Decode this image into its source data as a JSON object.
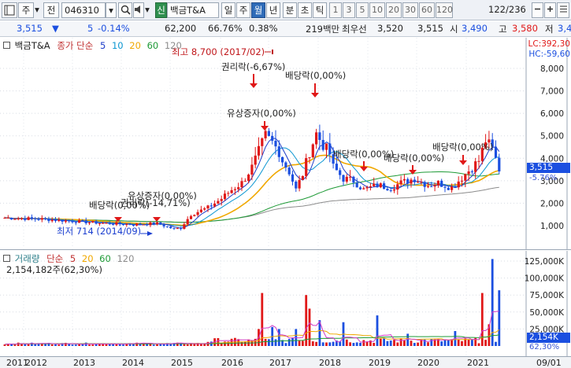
{
  "toolbar": {
    "type_label": "주",
    "jeon_label": "전",
    "code": "046310",
    "badge": "신",
    "name": "백금T&A",
    "periods": [
      "일",
      "주",
      "월",
      "년"
    ],
    "intervals": [
      "분",
      "초",
      "틱"
    ],
    "numbers": [
      "1",
      "3",
      "5",
      "10",
      "20",
      "30",
      "60",
      "120"
    ],
    "count": "122",
    "total": "/236"
  },
  "quote": {
    "price": "3,515",
    "arrow": "▼",
    "change": "5",
    "change_pct": "-0.14%",
    "volume": "62,200",
    "vol_ratio": "66.76%",
    "turnover": "0.38%",
    "amount": "219백만",
    "best_label": "최우선",
    "best_ask": "3,520",
    "best_bid": "3,515",
    "open_label": "시",
    "open": "3,490",
    "high_label": "고",
    "high": "3,580",
    "low_label": "저",
    "low": "3,4"
  },
  "price_chart": {
    "legend_name": "백금T&A",
    "legend_type": "종가 단순",
    "ma_periods": [
      "5",
      "10",
      "20",
      "60",
      "120"
    ],
    "lc": "LC:392,30",
    "hc": "HC:-59,60",
    "current": "3,515",
    "ma_pct": "-5.76%",
    "y_ticks": [
      "8,000",
      "7,000",
      "6,000",
      "5,000",
      "4,000",
      "3,000",
      "2,000",
      "1,000"
    ],
    "annotations": {
      "high": "최고 8,700 (2017/02)",
      "low": "최저 714 (2014/09)",
      "rights": "권리락(-6,67%)",
      "div_2017": "배당락(0,00%)",
      "paid_in": "유상증자(0,00%)",
      "div_2018": "배당락(0,00%)",
      "div_2019": "배당락(0,00%)",
      "div_2020": "배당락(0,00%)",
      "div_2014": "배당락(0,00%)",
      "paid_in_2014": "유상증자(0,00%)",
      "rights_2014": "권리락(-14,71%)"
    }
  },
  "volume_chart": {
    "legend_name": "거래량",
    "legend_type": "단순",
    "ma_periods": [
      "5",
      "20",
      "60",
      "120"
    ],
    "info": "2,154,182주(62,30%)",
    "y_ticks": [
      "125,000K",
      "100,000K",
      "75,000K",
      "50,000K",
      "25,000K"
    ],
    "current": "2,154K",
    "pct": "62,30%"
  },
  "time_axis": [
    "2011",
    "2012",
    "2013",
    "2014",
    "2015",
    "2016",
    "2017",
    "2018",
    "2019",
    "2020",
    "2021",
    "09/01"
  ],
  "colors": {
    "up": "#e01818",
    "down": "#1b4fe0",
    "ma5": "#1d3cc8",
    "ma10": "#0d97d2",
    "ma20": "#f0a800",
    "ma60": "#1e9a36",
    "ma120": "#8c8c8c"
  }
}
